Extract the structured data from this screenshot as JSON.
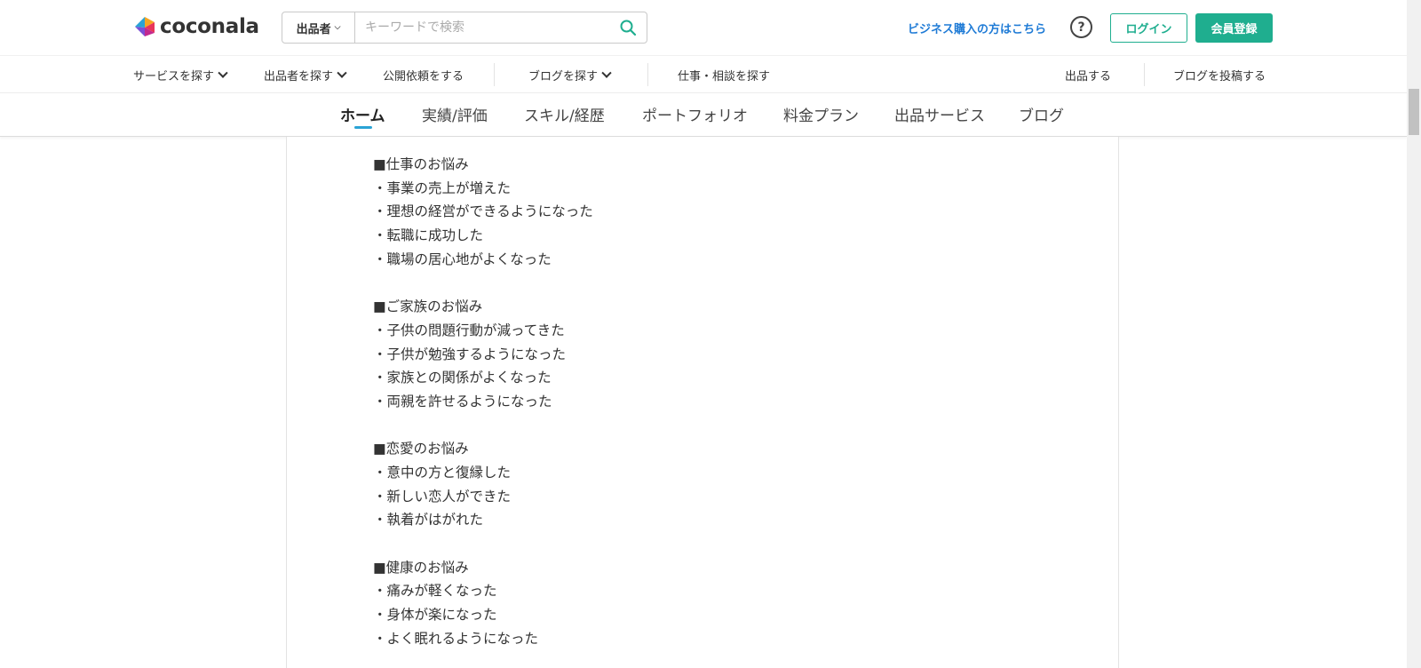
{
  "header": {
    "logo_text": "coconala",
    "search": {
      "scope_label": "出品者",
      "placeholder": "キーワードで検索",
      "value": ""
    },
    "business_link": "ビジネス購入の方はこちら",
    "help_label": "?",
    "login_label": "ログイン",
    "register_label": "会員登録"
  },
  "nav": {
    "items": [
      {
        "label": "サービスを探す",
        "chevron": true
      },
      {
        "label": "出品者を探す",
        "chevron": true
      },
      {
        "label": "公開依頼をする",
        "chevron": false
      },
      {
        "label": "ブログを探す",
        "chevron": true
      },
      {
        "label": "仕事・相談を探す",
        "chevron": false
      }
    ],
    "right_items": [
      {
        "label": "出品する"
      },
      {
        "label": "ブログを投稿する"
      }
    ]
  },
  "tabs": [
    {
      "label": "ホーム",
      "active": true
    },
    {
      "label": "実績/評価",
      "active": false
    },
    {
      "label": "スキル/経歴",
      "active": false
    },
    {
      "label": "ポートフォリオ",
      "active": false
    },
    {
      "label": "料金プラン",
      "active": false
    },
    {
      "label": "出品サービス",
      "active": false
    },
    {
      "label": "ブログ",
      "active": false
    }
  ],
  "content": {
    "lines": [
      "■仕事のお悩み",
      "・事業の売上が増えた",
      "・理想の経営ができるようになった",
      "・転職に成功した",
      "・職場の居心地がよくなった",
      "",
      "■ご家族のお悩み",
      "・子供の問題行動が減ってきた",
      "・子供が勉強するようになった",
      "・家族との関係がよくなった",
      "・両親を許せるようになった",
      "",
      "■恋愛のお悩み",
      "・意中の方と復縁した",
      "・新しい恋人ができた",
      "・執着がはがれた",
      "",
      "■健康のお悩み",
      "・痛みが軽くなった",
      "・身体が楽になった",
      "・よく眠れるようになった"
    ]
  },
  "colors": {
    "brand_green": "#1fae8f",
    "link_blue": "#1f7bd6",
    "tab_underline": "#2aa3d5"
  }
}
